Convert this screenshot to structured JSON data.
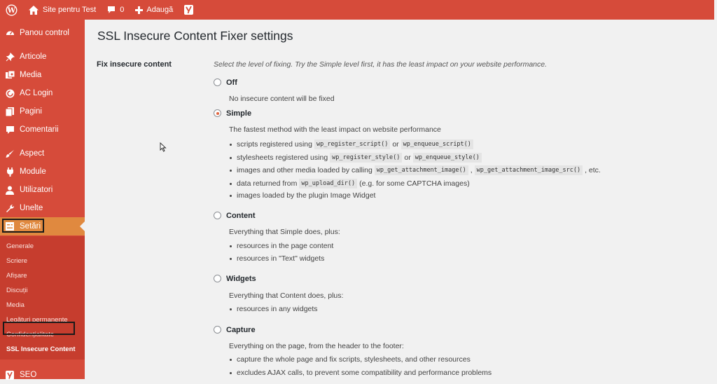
{
  "colors": {
    "admin_red": "#d64b3a",
    "active_orange": "#e0893f",
    "submenu_red": "#c63d2e"
  },
  "adminbar": {
    "site_name": "Site pentru Test",
    "comments_count": "0",
    "add_new": "Adaugă"
  },
  "sidebar": {
    "items": [
      {
        "label": "Panou control",
        "icon": "dashboard-icon"
      },
      {
        "label": "Articole",
        "icon": "pin-icon"
      },
      {
        "label": "Media",
        "icon": "media-icon"
      },
      {
        "label": "AC Login",
        "icon": "ac-login-icon"
      },
      {
        "label": "Pagini",
        "icon": "page-icon"
      },
      {
        "label": "Comentarii",
        "icon": "comment-icon"
      },
      {
        "label": "Aspect",
        "icon": "brush-icon"
      },
      {
        "label": "Module",
        "icon": "plugin-icon"
      },
      {
        "label": "Utilizatori",
        "icon": "user-icon"
      },
      {
        "label": "Unelte",
        "icon": "wrench-icon"
      },
      {
        "label": "Setări",
        "icon": "settings-icon"
      },
      {
        "label": "SEO",
        "icon": "yoast-icon"
      }
    ],
    "submenu": [
      "Generale",
      "Scriere",
      "Afișare",
      "Discuții",
      "Media",
      "Legături permanente",
      "Confidențialitate",
      "SSL Insecure Content"
    ]
  },
  "page": {
    "title": "SSL Insecure Content Fixer settings",
    "field_label": "Fix insecure content",
    "field_description": "Select the level of fixing. Try the Simple level first, it has the least impact on your website performance.",
    "selected_option": "Simple",
    "options": {
      "off": {
        "label": "Off",
        "text": "No insecure content will be fixed"
      },
      "simple": {
        "label": "Simple",
        "text": "The fastest method with the least impact on website performance",
        "b1_pre": "scripts registered using",
        "b1_c1": "wp_register_script()",
        "b1_or": "or",
        "b1_c2": "wp_enqueue_script()",
        "b2_pre": "stylesheets registered using",
        "b2_c1": "wp_register_style()",
        "b2_or": "or",
        "b2_c2": "wp_enqueue_style()",
        "b3_pre": "images and other media loaded by calling",
        "b3_c1": "wp_get_attachment_image()",
        "b3_comma": ",",
        "b3_c2": "wp_get_attachment_image_src()",
        "b3_post": ", etc.",
        "b4_pre": "data returned from",
        "b4_c1": "wp_upload_dir()",
        "b4_post": "(e.g. for some CAPTCHA images)",
        "b5": "images loaded by the plugin Image Widget"
      },
      "content": {
        "label": "Content",
        "text": "Everything that Simple does, plus:",
        "b1": "resources in the page content",
        "b2": "resources in \"Text\" widgets"
      },
      "widgets": {
        "label": "Widgets",
        "text": "Everything that Content does, plus:",
        "b1": "resources in any widgets"
      },
      "capture": {
        "label": "Capture",
        "text": "Everything on the page, from the header to the footer:",
        "b1": "capture the whole page and fix scripts, stylesheets, and other resources",
        "b2": "excludes AJAX calls, to prevent some compatibility and performance problems"
      }
    }
  }
}
